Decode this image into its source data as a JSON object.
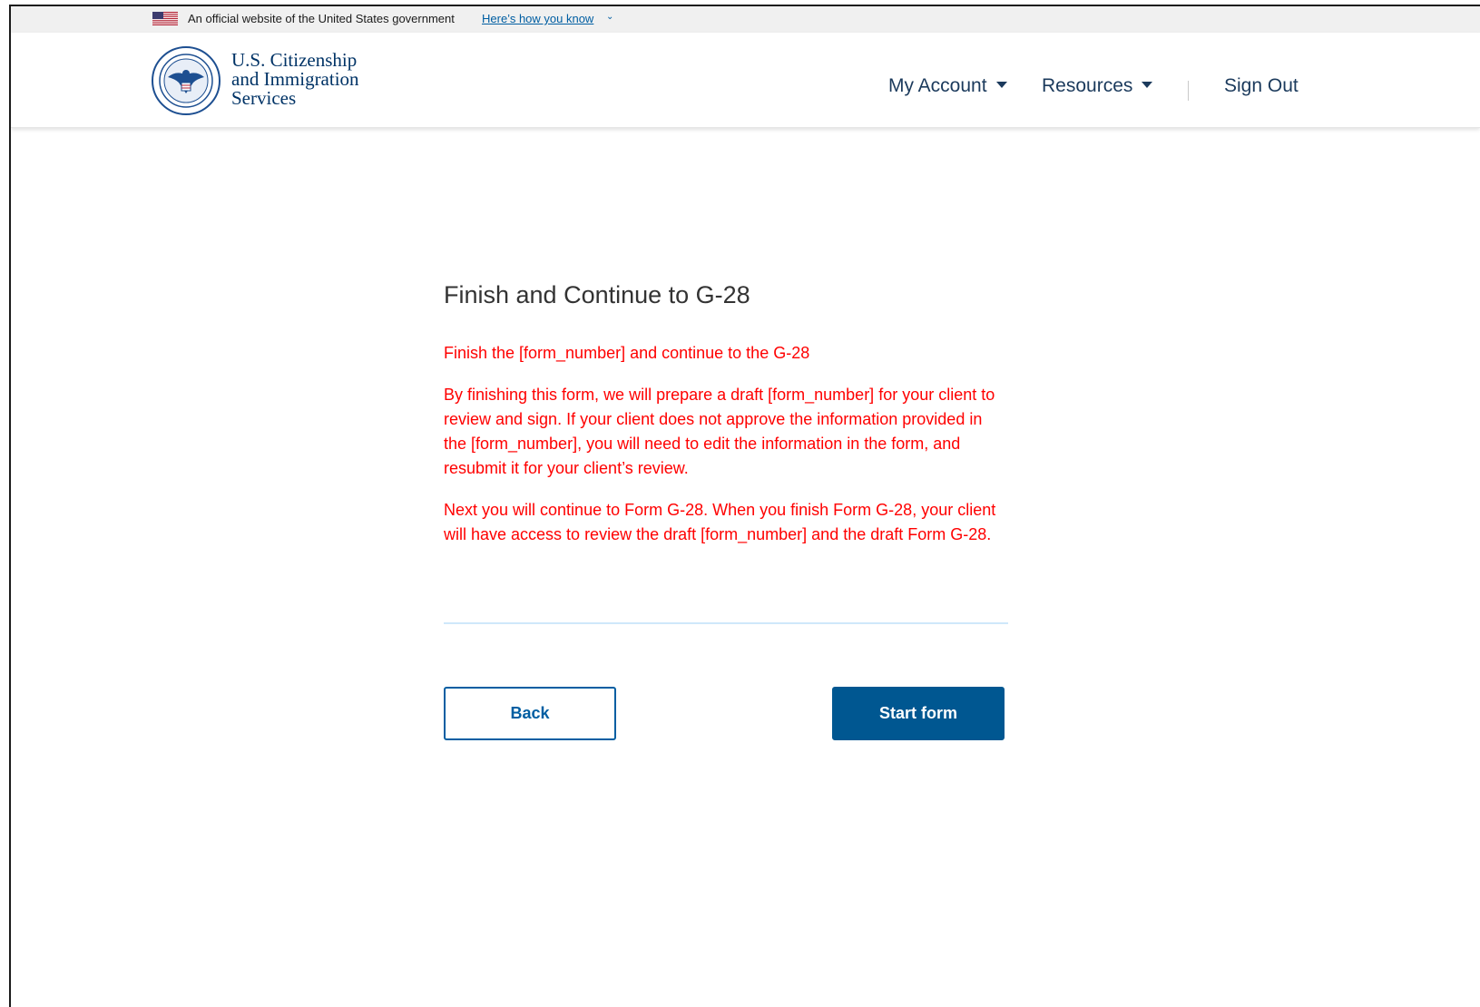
{
  "gov_banner": {
    "text": "An official website of the United States government",
    "link": "Here’s how you know",
    "chevron": "⌄"
  },
  "header": {
    "agency_line1": "U.S. Citizenship",
    "agency_line2": "and Immigration",
    "agency_line3": "Services",
    "logo_icon": "dhs-seal-icon",
    "nav": {
      "my_account": "My Account",
      "resources": "Resources",
      "sign_out": "Sign Out"
    }
  },
  "main": {
    "title": "Finish and Continue to G-28",
    "para1": "Finish the [form_number] and continue to the G-28",
    "para2": "By finishing this form, we will prepare a draft [form_number] for your client to review and sign. If your client does not approve the information provided in the [form_number], you will need to edit the information in the form, and resubmit it for your client’s review.",
    "para3": "Next you will continue to Form G-28. When you finish Form G-28, your client will have access to review the draft [form_number] and the draft Form G-28."
  },
  "buttons": {
    "back": "Back",
    "start": "Start form"
  },
  "colors": {
    "accent": "#005ea2",
    "primary_button": "#005791",
    "warning_text": "#ff0000",
    "agency_blue": "#003366"
  }
}
